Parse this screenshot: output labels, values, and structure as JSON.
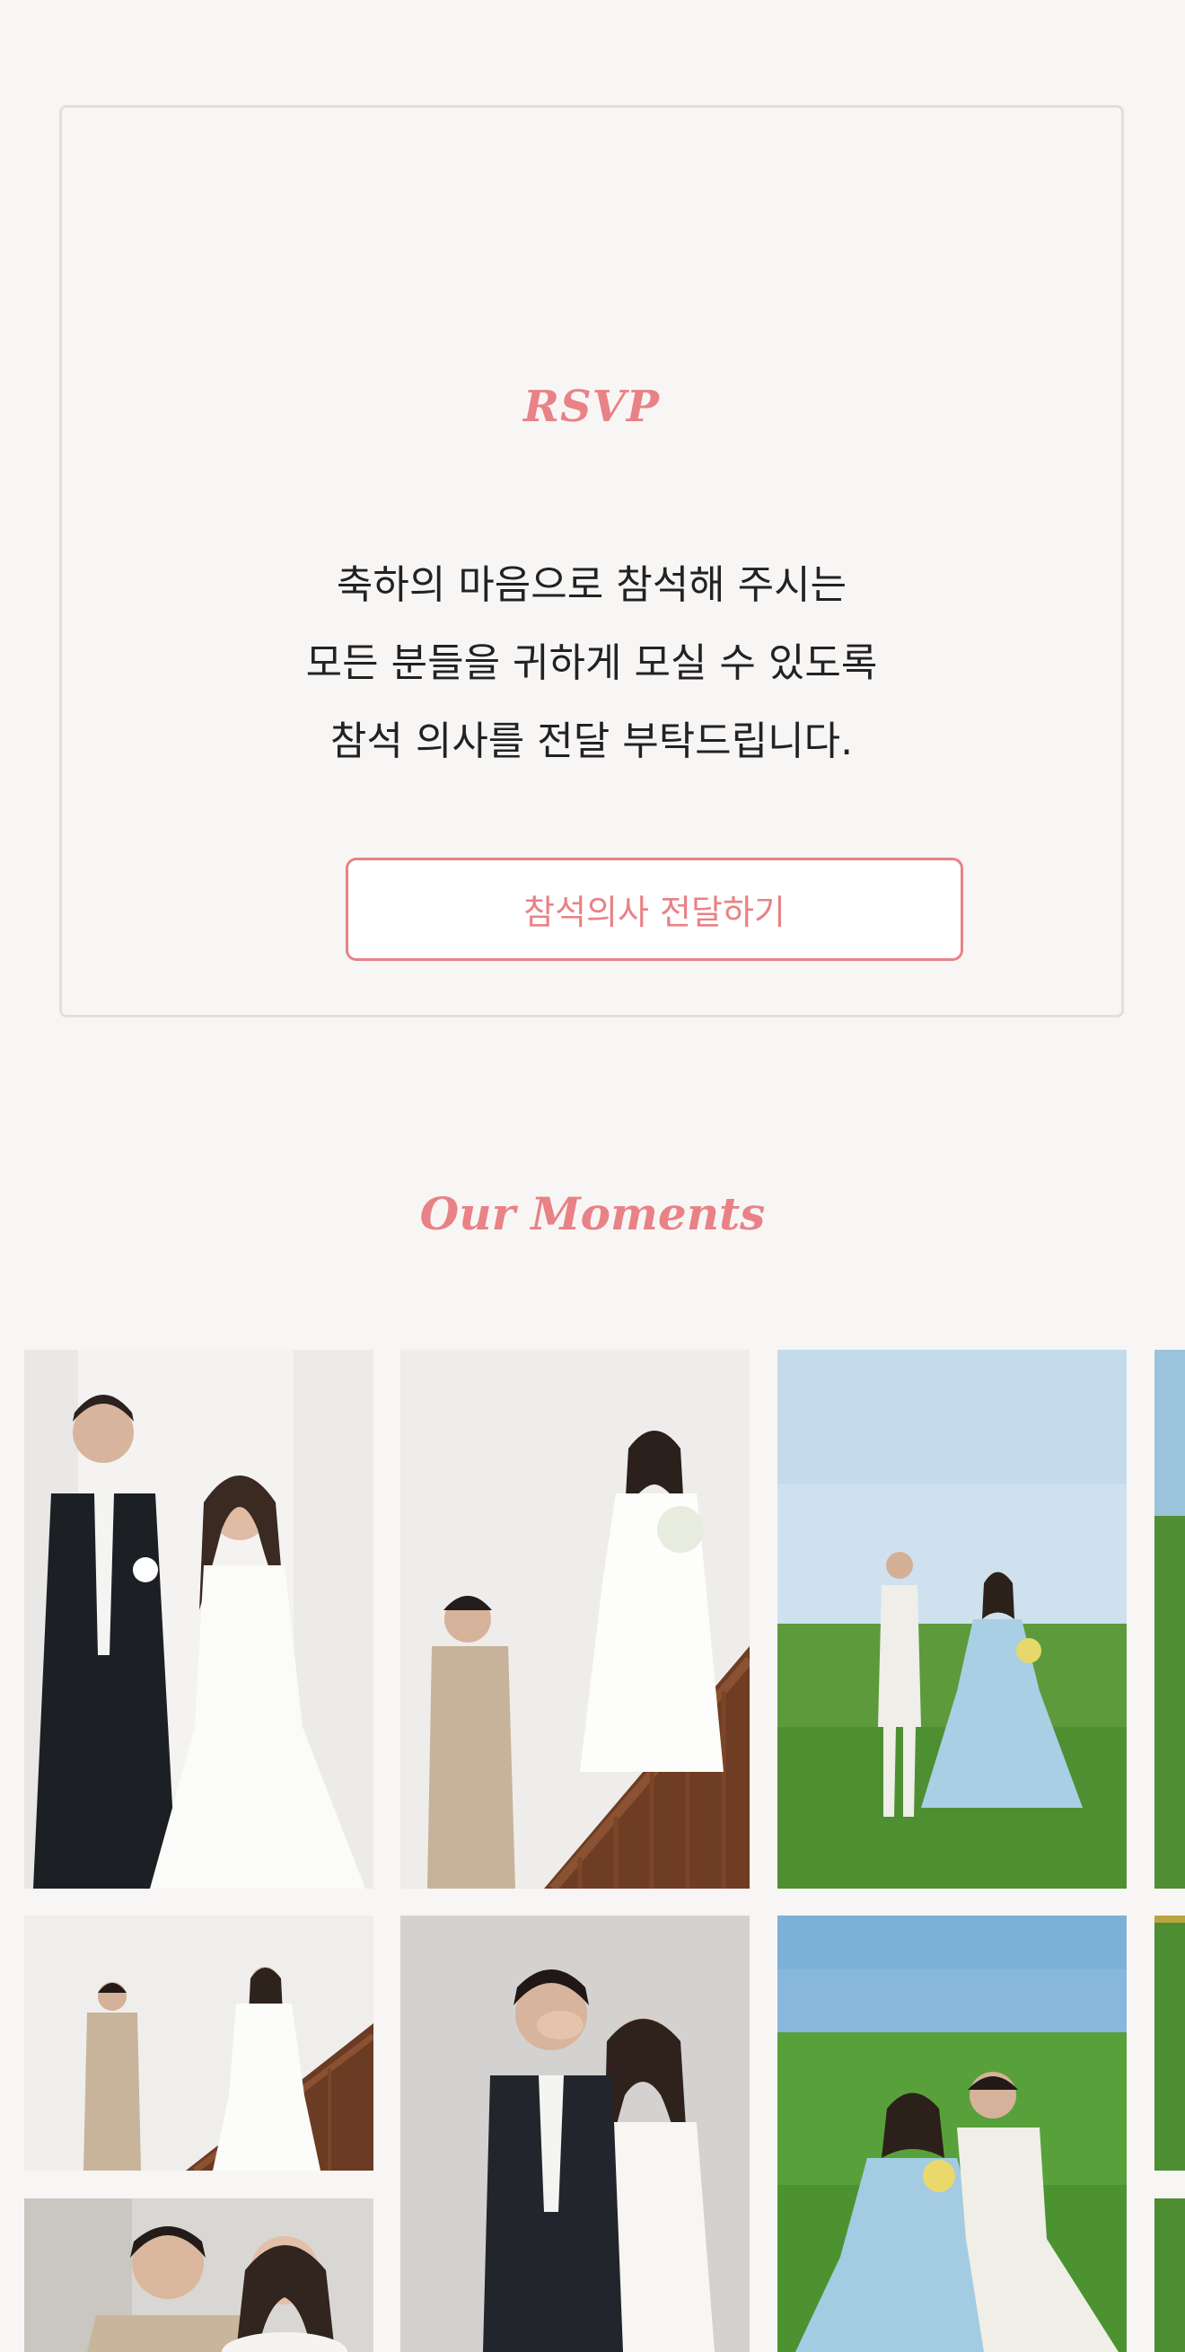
{
  "rsvp": {
    "title": "RSVP",
    "message_lines": [
      "축하의 마음으로 참석해 주시는",
      "모든 분들을 귀하게 모실 수 있도록",
      "참석 의사를 전달 부탁드립니다."
    ],
    "button_label": "참석의사 전달하기"
  },
  "moments": {
    "title": "Our Moments"
  },
  "colors": {
    "background": "#f8f6f5",
    "accent": "#e88286",
    "text": "#222222",
    "border": "#e2dedc"
  }
}
